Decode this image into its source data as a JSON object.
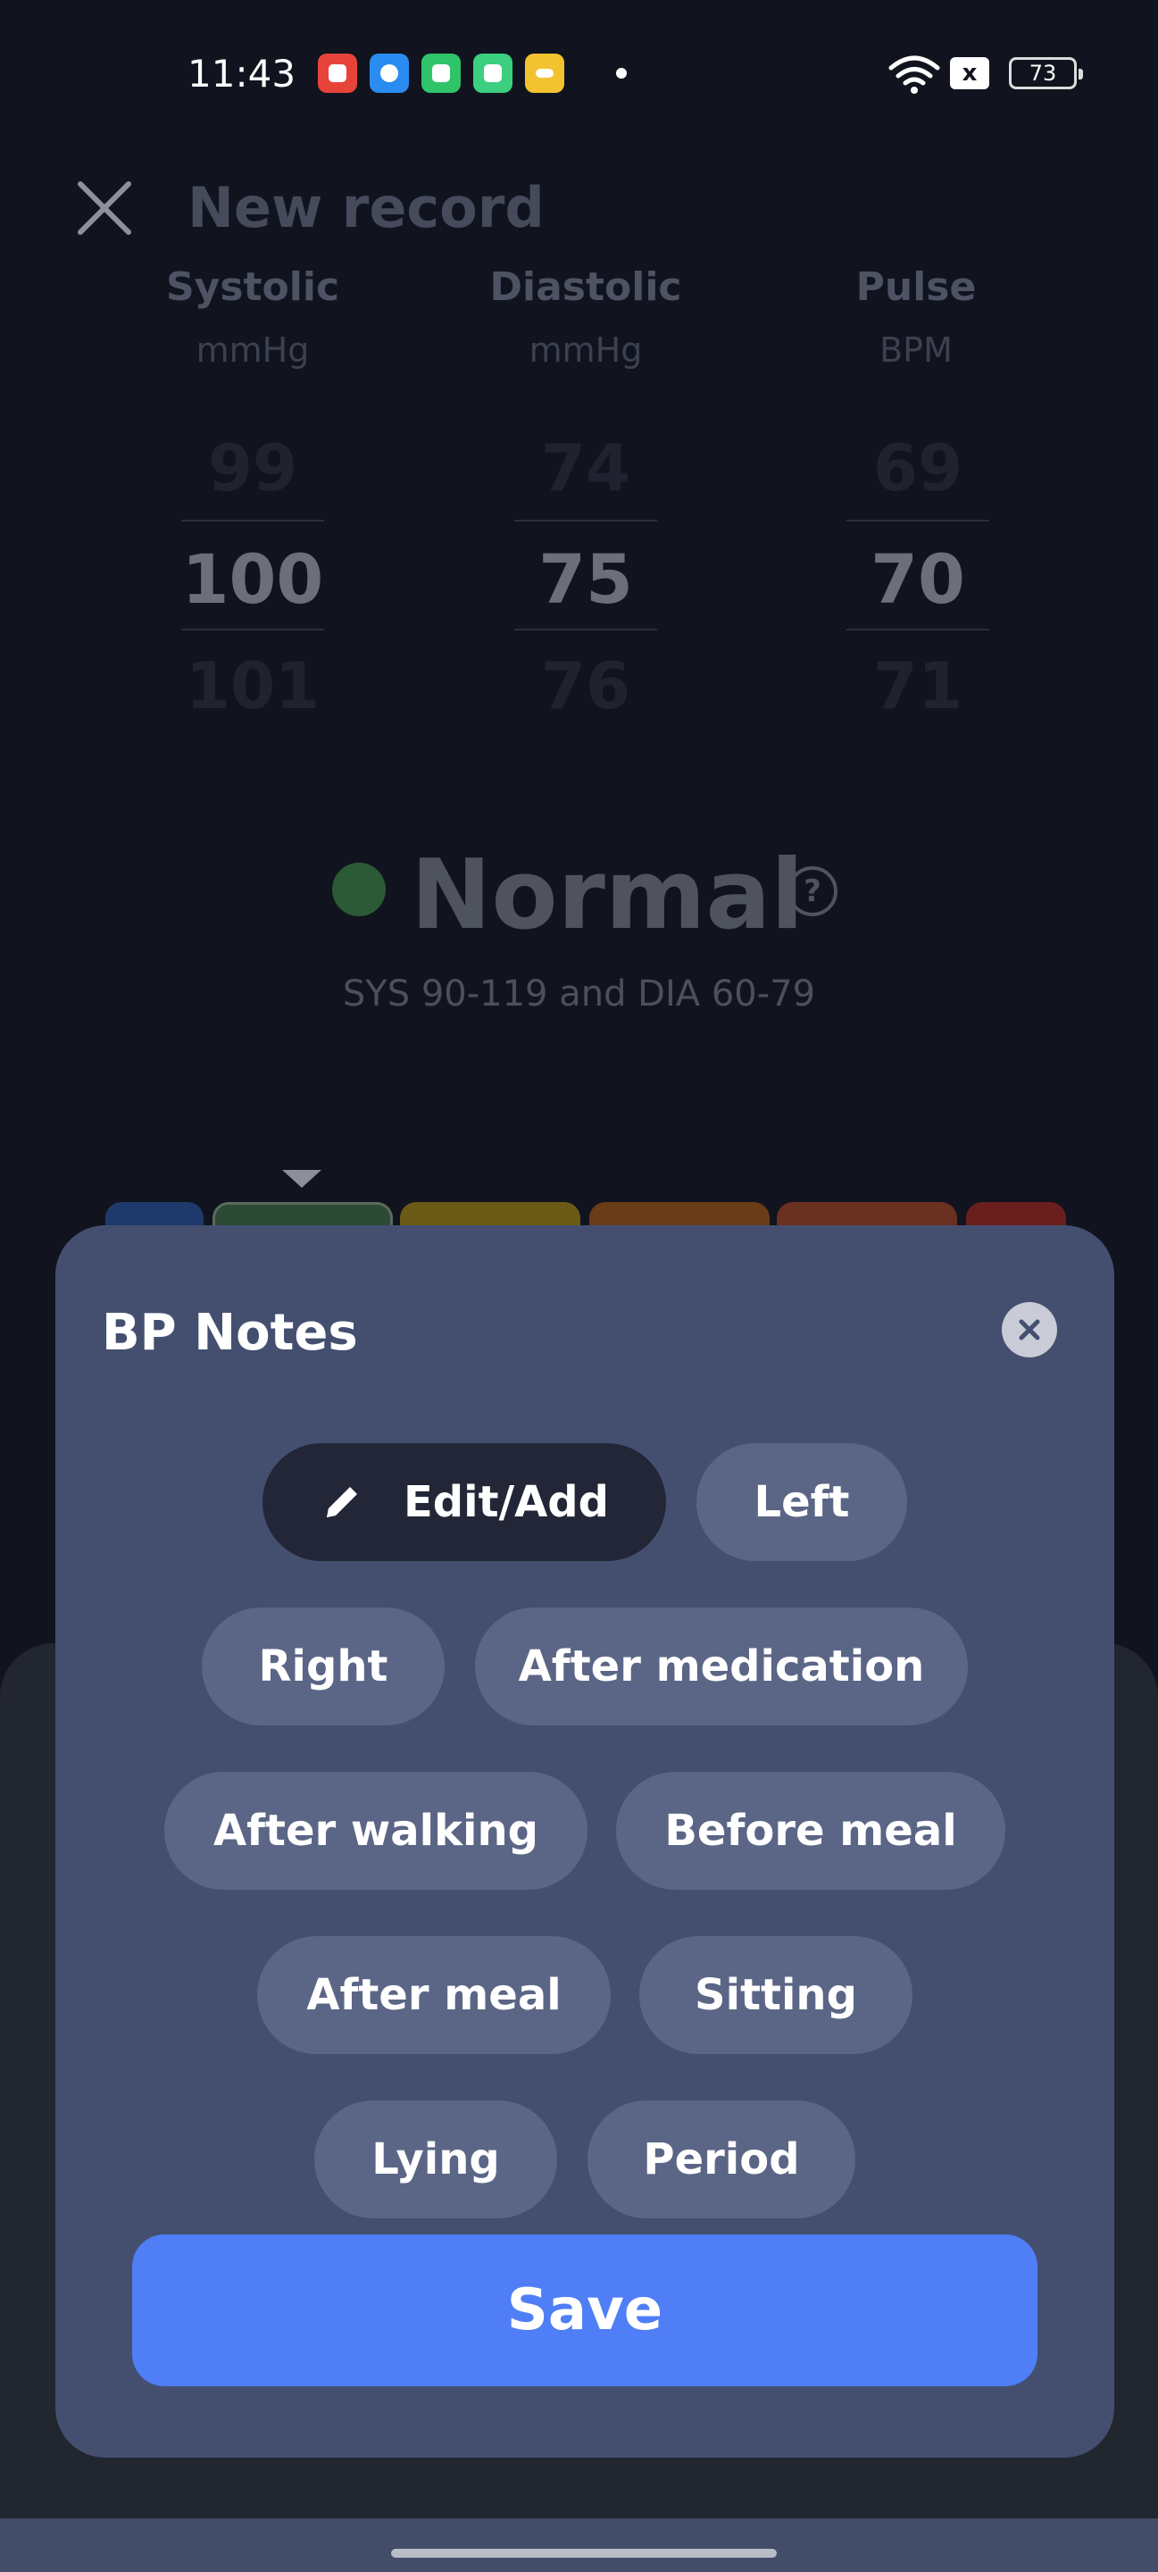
{
  "status_bar": {
    "time": "11:43",
    "battery": "73",
    "sim_label": "x",
    "app_icons": [
      {
        "name": "video-app-icon",
        "color": "#e8433b"
      },
      {
        "name": "browser-app-icon",
        "color": "#2a8cf0"
      },
      {
        "name": "green-app-icon",
        "color": "#2fc46a"
      },
      {
        "name": "notes-app-icon",
        "color": "#3ccf7f"
      },
      {
        "name": "yellow-app-icon",
        "color": "#f2c230"
      }
    ]
  },
  "header": {
    "title": "New record",
    "close_icon": "close-icon"
  },
  "readings": {
    "systolic": {
      "label": "Systolic",
      "unit": "mmHg",
      "prev": "99",
      "value": "100",
      "next": "101"
    },
    "diastolic": {
      "label": "Diastolic",
      "unit": "mmHg",
      "prev": "74",
      "value": "75",
      "next": "76"
    },
    "pulse": {
      "label": "Pulse",
      "unit": "BPM",
      "prev": "69",
      "value": "70",
      "next": "71"
    }
  },
  "status": {
    "label": "Normal",
    "help_symbol": "?",
    "range": "SYS 90-119 and DIA 60-79",
    "indicator_color": "#2c5a36"
  },
  "scale_colors": [
    "#1f3a6a",
    "#2c4a36",
    "#6b5a16",
    "#6a3c18",
    "#6a3020",
    "#6a1e1e"
  ],
  "sheet": {
    "title": "BP Notes",
    "edit_chip": "Edit/Add",
    "chips": [
      "Left",
      "Right",
      "After medication",
      "After walking",
      "Before meal",
      "After meal",
      "Sitting",
      "Lying",
      "Period"
    ],
    "save": "Save"
  },
  "colors": {
    "sheet_bg": "#444f70",
    "chip_bg": "#5b6686",
    "edit_chip_bg": "#222637",
    "save_bg": "#4f7ef6"
  }
}
